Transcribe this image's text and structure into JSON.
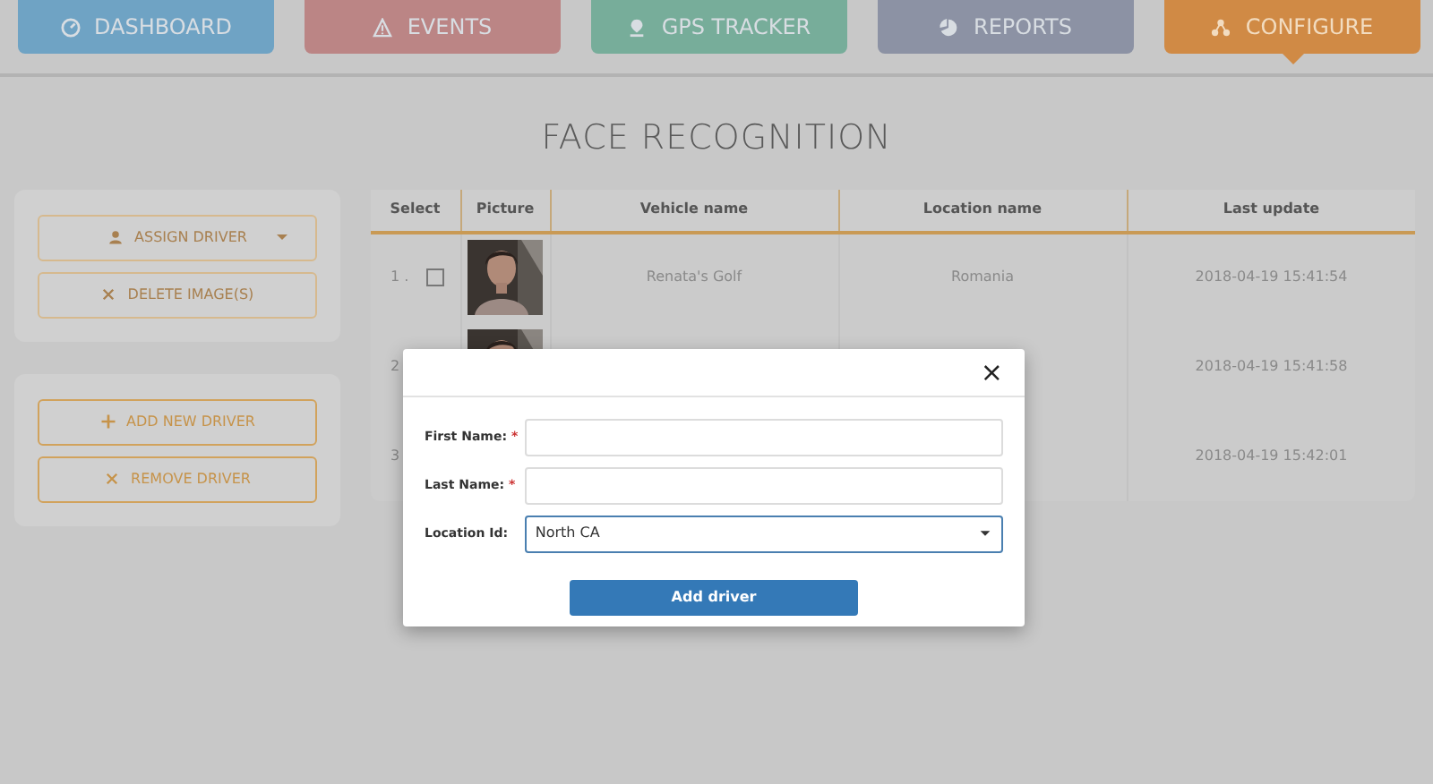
{
  "nav_tabs": [
    {
      "label": "DASHBOARD",
      "color": "#6fa3c4",
      "selected": false
    },
    {
      "label": "EVENTS",
      "color": "#bb8585",
      "selected": false
    },
    {
      "label": "GPS TRACKER",
      "color": "#77ad9a",
      "selected": false
    },
    {
      "label": "REPORTS",
      "color": "#8c92a4",
      "selected": false
    },
    {
      "label": "CONFIGURE",
      "color": "#d08a45",
      "selected": true
    }
  ],
  "page_title": "FACE RECOGNITION",
  "side_panels": [
    {
      "buttons": [
        {
          "label": "ASSIGN DRIVER",
          "disabled": true
        },
        {
          "label": "DELETE IMAGE(S)",
          "disabled": true
        }
      ]
    },
    {
      "buttons": [
        {
          "label": "ADD NEW DRIVER",
          "disabled": false
        },
        {
          "label": "REMOVE DRIVER",
          "disabled": false
        }
      ]
    }
  ],
  "table": {
    "columns": [
      "Select",
      "Picture",
      "Vehicle name",
      "Location name",
      "Last update"
    ],
    "rows": [
      {
        "number": "1 .",
        "checked": false,
        "vehicle_name": "Renata's Golf",
        "location_name": "Romania",
        "last_update": "2018-04-19 15:41:54"
      },
      {
        "number": "2",
        "last_update": "2018-04-19 15:41:58"
      },
      {
        "number": "3",
        "last_update": "2018-04-19 15:42:01"
      }
    ]
  },
  "modal": {
    "close": "×",
    "fields": [
      {
        "kind": "text",
        "label": "First Name:",
        "required_mark": "*"
      },
      {
        "kind": "text",
        "label": "Last Name:",
        "required_mark": "*"
      },
      {
        "kind": "select",
        "label": "Location Id:",
        "value": "North CA"
      }
    ],
    "submit": "Add driver"
  }
}
